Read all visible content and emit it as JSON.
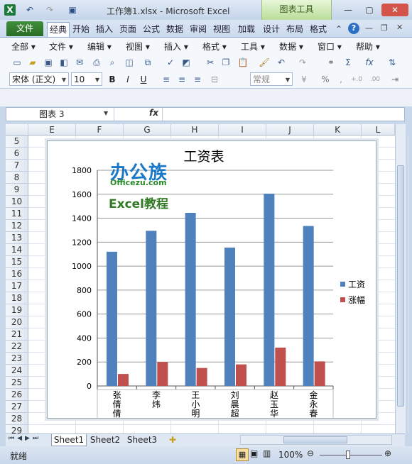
{
  "window": {
    "title": "工作簿1.xlsx  -  Microsoft Excel",
    "context_tab": "图表工具",
    "qat_icons": [
      "excel-icon",
      "undo-icon",
      "redo-icon",
      "save-icon"
    ]
  },
  "ribbon": {
    "file_tab": "文件",
    "tabs": [
      "经典",
      "开始",
      "插入",
      "页面",
      "公式",
      "数据",
      "审阅",
      "视图",
      "加载",
      "设计",
      "布局",
      "格式"
    ]
  },
  "menus": [
    "全部",
    "文件",
    "编辑",
    "视图",
    "插入",
    "格式",
    "工具",
    "数据",
    "窗口",
    "帮助"
  ],
  "toolbar": {
    "font_name": "宋体 (正文)",
    "font_size": "10",
    "bold": "B",
    "italic": "I",
    "underline": "U",
    "number_format": "常规",
    "percent": "%"
  },
  "formula_bar": {
    "name_box": "图表 3",
    "fx_label": "fx"
  },
  "columns": [
    "E",
    "F",
    "G",
    "H",
    "I",
    "J",
    "K",
    "L"
  ],
  "rows": [
    "5",
    "6",
    "7",
    "8",
    "9",
    "10",
    "11",
    "12",
    "13",
    "14",
    "15",
    "16",
    "17",
    "18",
    "19",
    "20",
    "21",
    "22",
    "23",
    "24",
    "25",
    "26",
    "27",
    "28",
    "29"
  ],
  "logo": {
    "line1": "办公族",
    "line2": "Officezu.com",
    "line3": "Excel教程"
  },
  "chart_data": {
    "type": "bar",
    "title": "工资表",
    "categories": [
      "张倩倩",
      "李炜",
      "王小明",
      "刘晨超",
      "赵玉华",
      "金永春"
    ],
    "series": [
      {
        "name": "工资",
        "values": [
          1120,
          1295,
          1445,
          1155,
          1605,
          1335
        ],
        "color": "#4f81bd"
      },
      {
        "name": "涨幅",
        "values": [
          100,
          200,
          150,
          180,
          320,
          205
        ],
        "color": "#c0504d"
      }
    ],
    "ylim": [
      0,
      1800
    ],
    "yticks": [
      "0",
      "200",
      "400",
      "600",
      "800",
      "1000",
      "1200",
      "1400",
      "1600",
      "1800"
    ],
    "grid": true,
    "legend": "right"
  },
  "sheets": [
    "Sheet1",
    "Sheet2",
    "Sheet3"
  ],
  "status": {
    "ready": "就绪",
    "zoom": "100%"
  }
}
